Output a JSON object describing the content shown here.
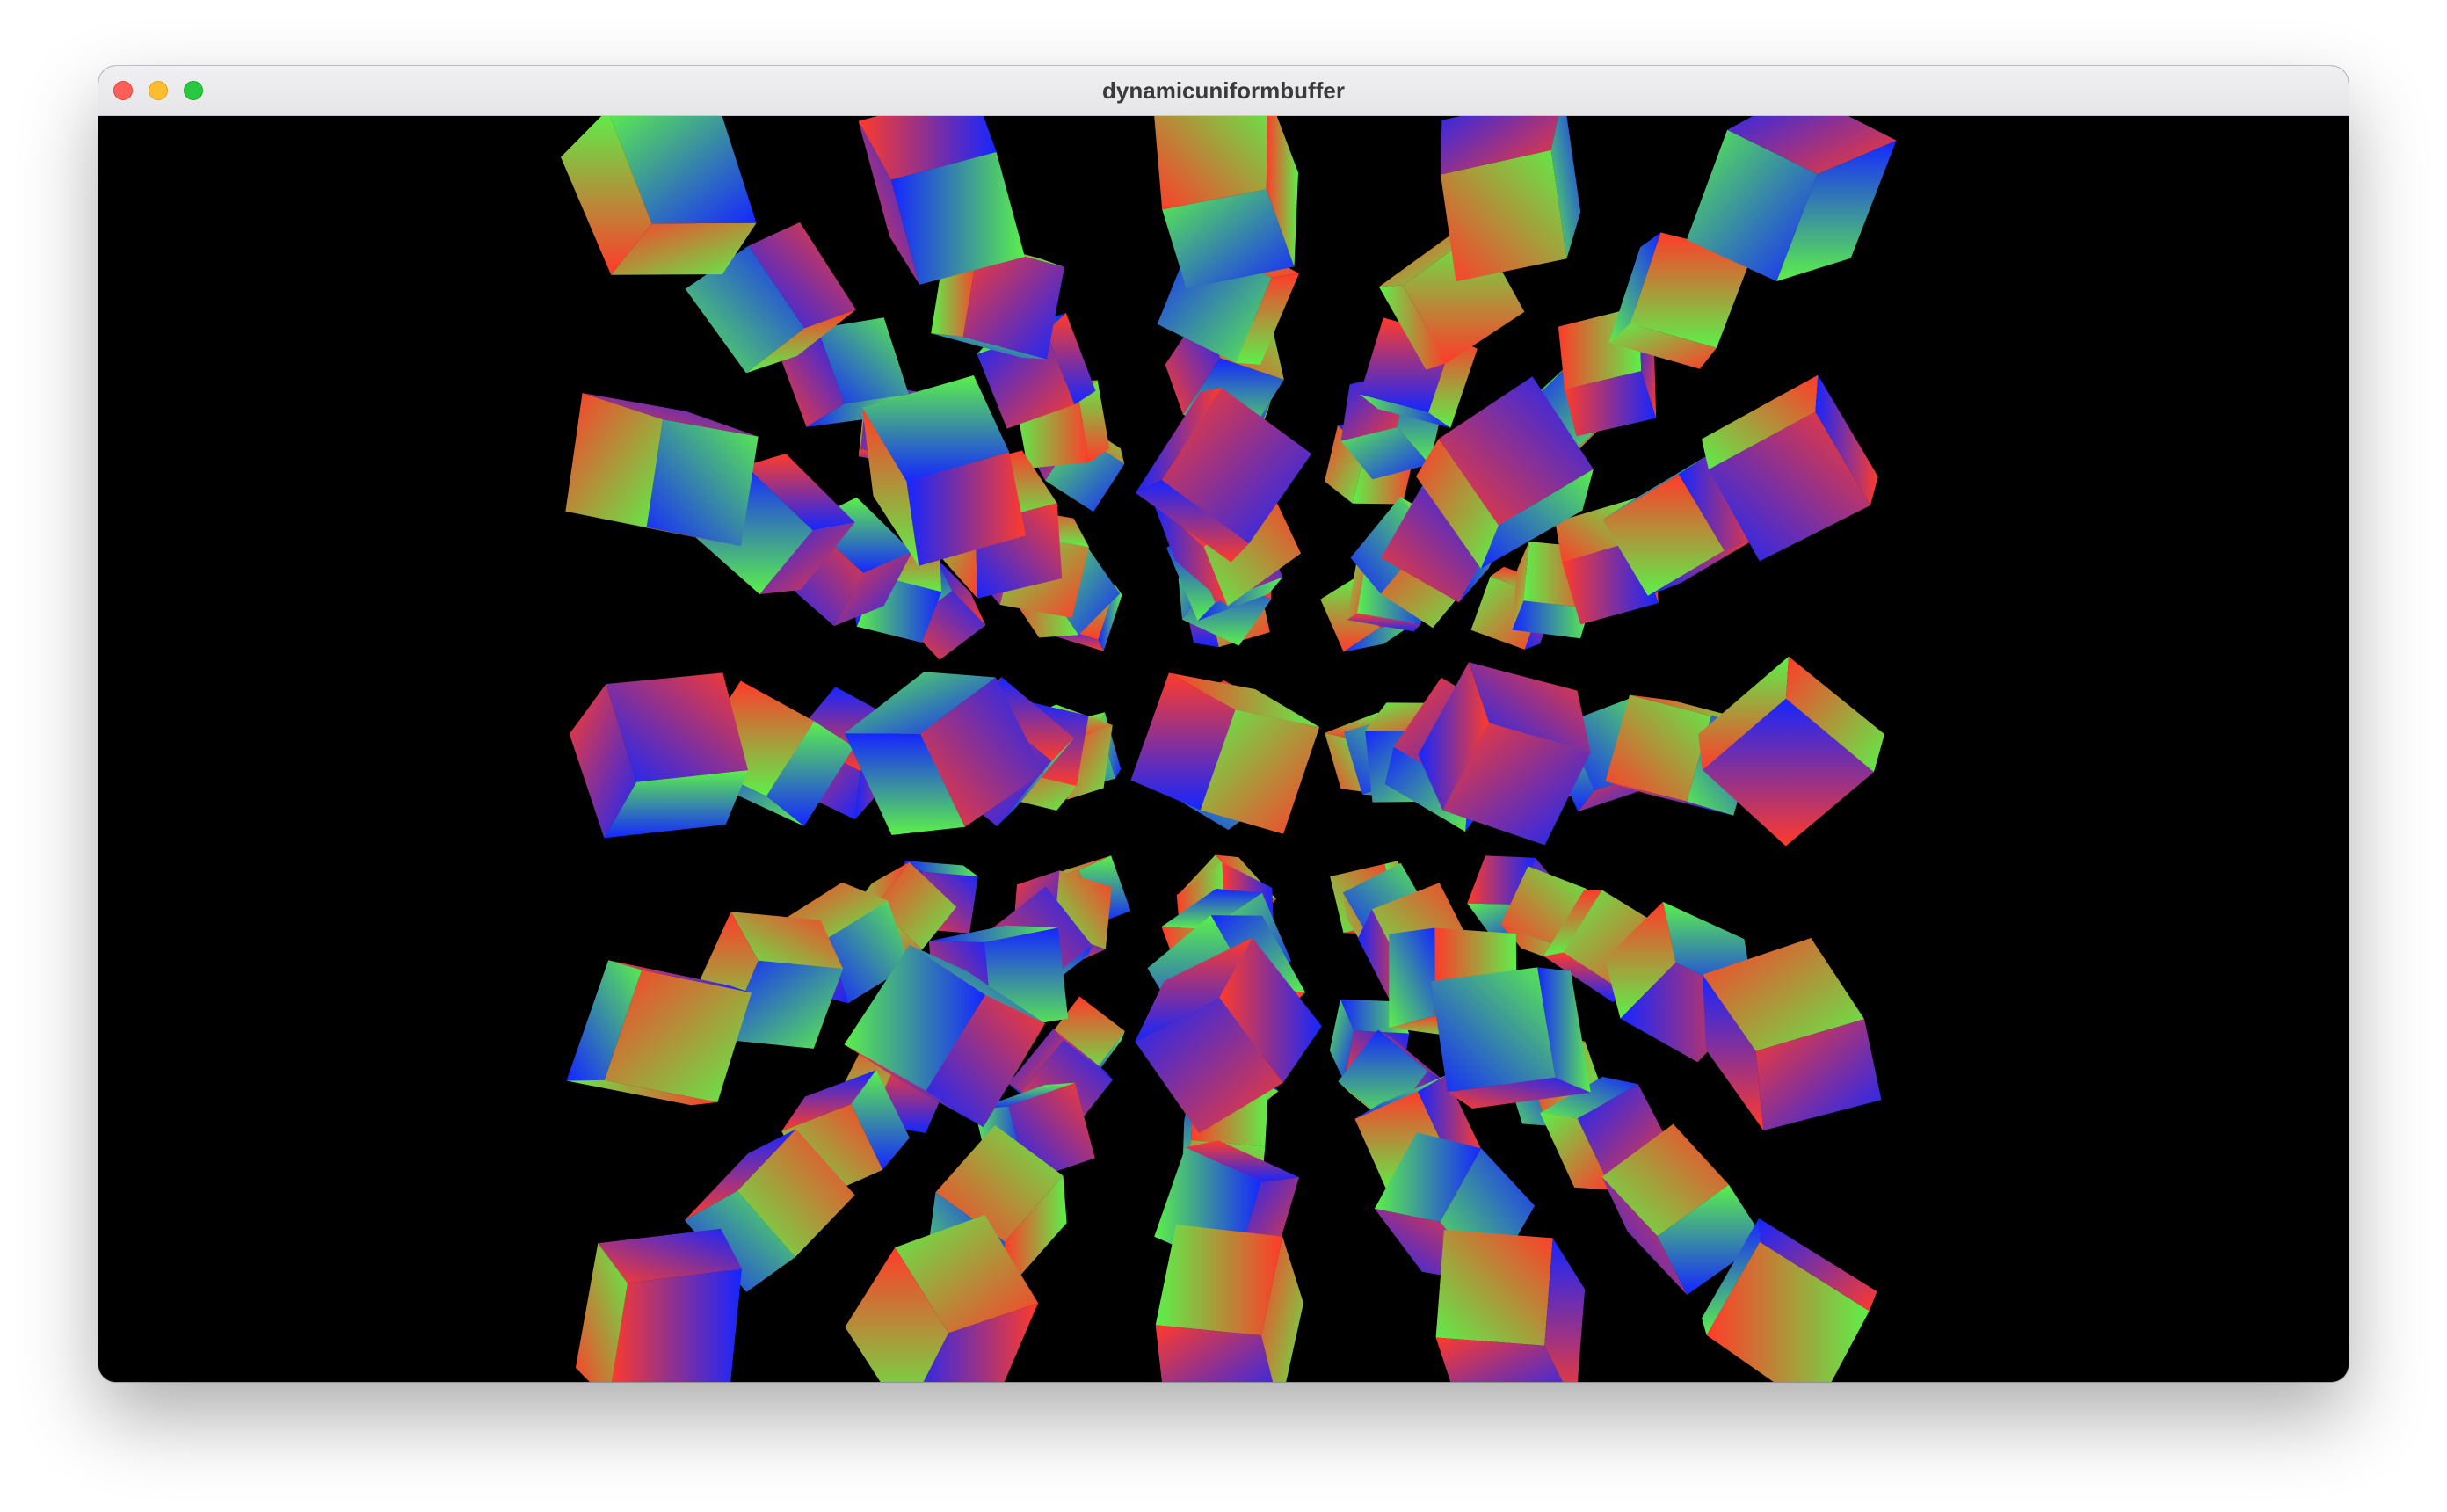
{
  "window": {
    "title": "dynamicuniformbuffer"
  },
  "window_controls": {
    "close": "close-button",
    "minimize": "minimize-button",
    "maximize": "zoom-button"
  },
  "scene": {
    "background": "#000000",
    "grid": [
      5,
      5,
      5
    ],
    "face_colors": [
      "#ff3b2a",
      "#5cf04a",
      "#1526ff"
    ]
  }
}
